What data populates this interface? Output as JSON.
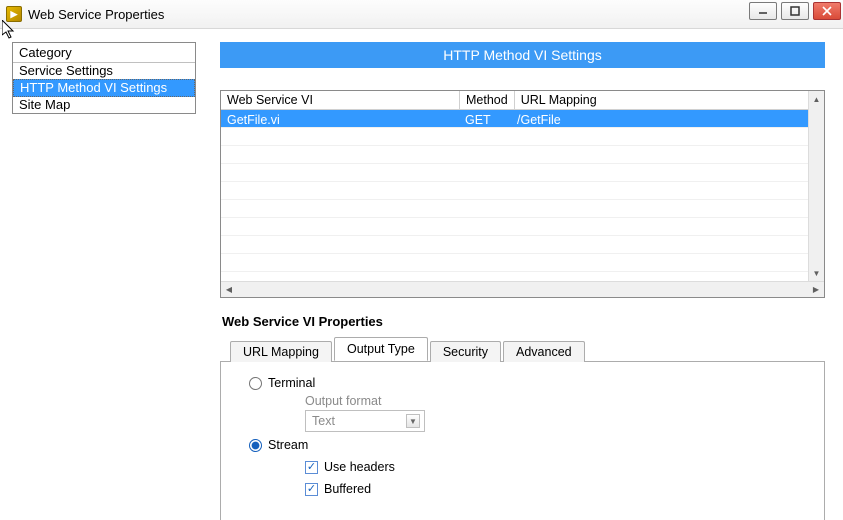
{
  "window": {
    "title": "Web Service Properties"
  },
  "sidebar": {
    "header": "Category",
    "items": [
      {
        "label": "Service Settings"
      },
      {
        "label": "HTTP Method VI Settings"
      },
      {
        "label": "Site Map"
      }
    ]
  },
  "banner": "HTTP Method VI Settings",
  "table": {
    "headers": {
      "vi": "Web Service VI",
      "method": "Method",
      "url": "URL Mapping"
    },
    "rows": [
      {
        "vi": "GetFile.vi",
        "method": "GET",
        "url": "/GetFile"
      }
    ]
  },
  "properties": {
    "heading": "Web Service VI Properties",
    "tabs": [
      {
        "label": "URL Mapping"
      },
      {
        "label": "Output Type"
      },
      {
        "label": "Security"
      },
      {
        "label": "Advanced"
      }
    ],
    "outputType": {
      "radio_terminal": "Terminal",
      "radio_stream": "Stream",
      "format_label": "Output format",
      "format_value": "Text",
      "use_headers": "Use headers",
      "buffered": "Buffered"
    }
  }
}
